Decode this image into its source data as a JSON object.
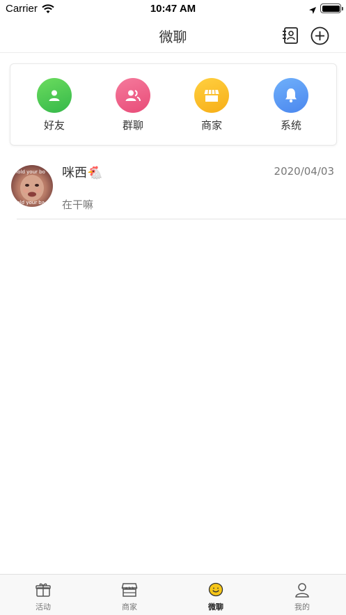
{
  "status_bar": {
    "carrier": "Carrier",
    "time": "10:47 AM"
  },
  "nav": {
    "title": "微聊"
  },
  "categories": [
    {
      "label": "好友",
      "color": "#4cc953",
      "icon": "person-icon"
    },
    {
      "label": "群聊",
      "color": "#f0648a",
      "icon": "group-icon"
    },
    {
      "label": "商家",
      "color": "#fbbd2c",
      "icon": "store-icon"
    },
    {
      "label": "系统",
      "color": "#5b9af5",
      "icon": "bell-icon"
    }
  ],
  "chats": [
    {
      "name": "咪西🐔",
      "date": "2020/04/03",
      "message": "在干嘛",
      "avatar_caption_top": "Hold your bo",
      "avatar_caption_bottom": "hold your ba"
    }
  ],
  "tabbar": {
    "tabs": [
      {
        "label": "活动",
        "icon": "gift-icon",
        "active": false
      },
      {
        "label": "商家",
        "icon": "store-icon",
        "active": false
      },
      {
        "label": "微聊",
        "icon": "chat-bubble-icon",
        "active": true
      },
      {
        "label": "我的",
        "icon": "user-icon",
        "active": false
      }
    ],
    "active_color": "#f5c518"
  }
}
